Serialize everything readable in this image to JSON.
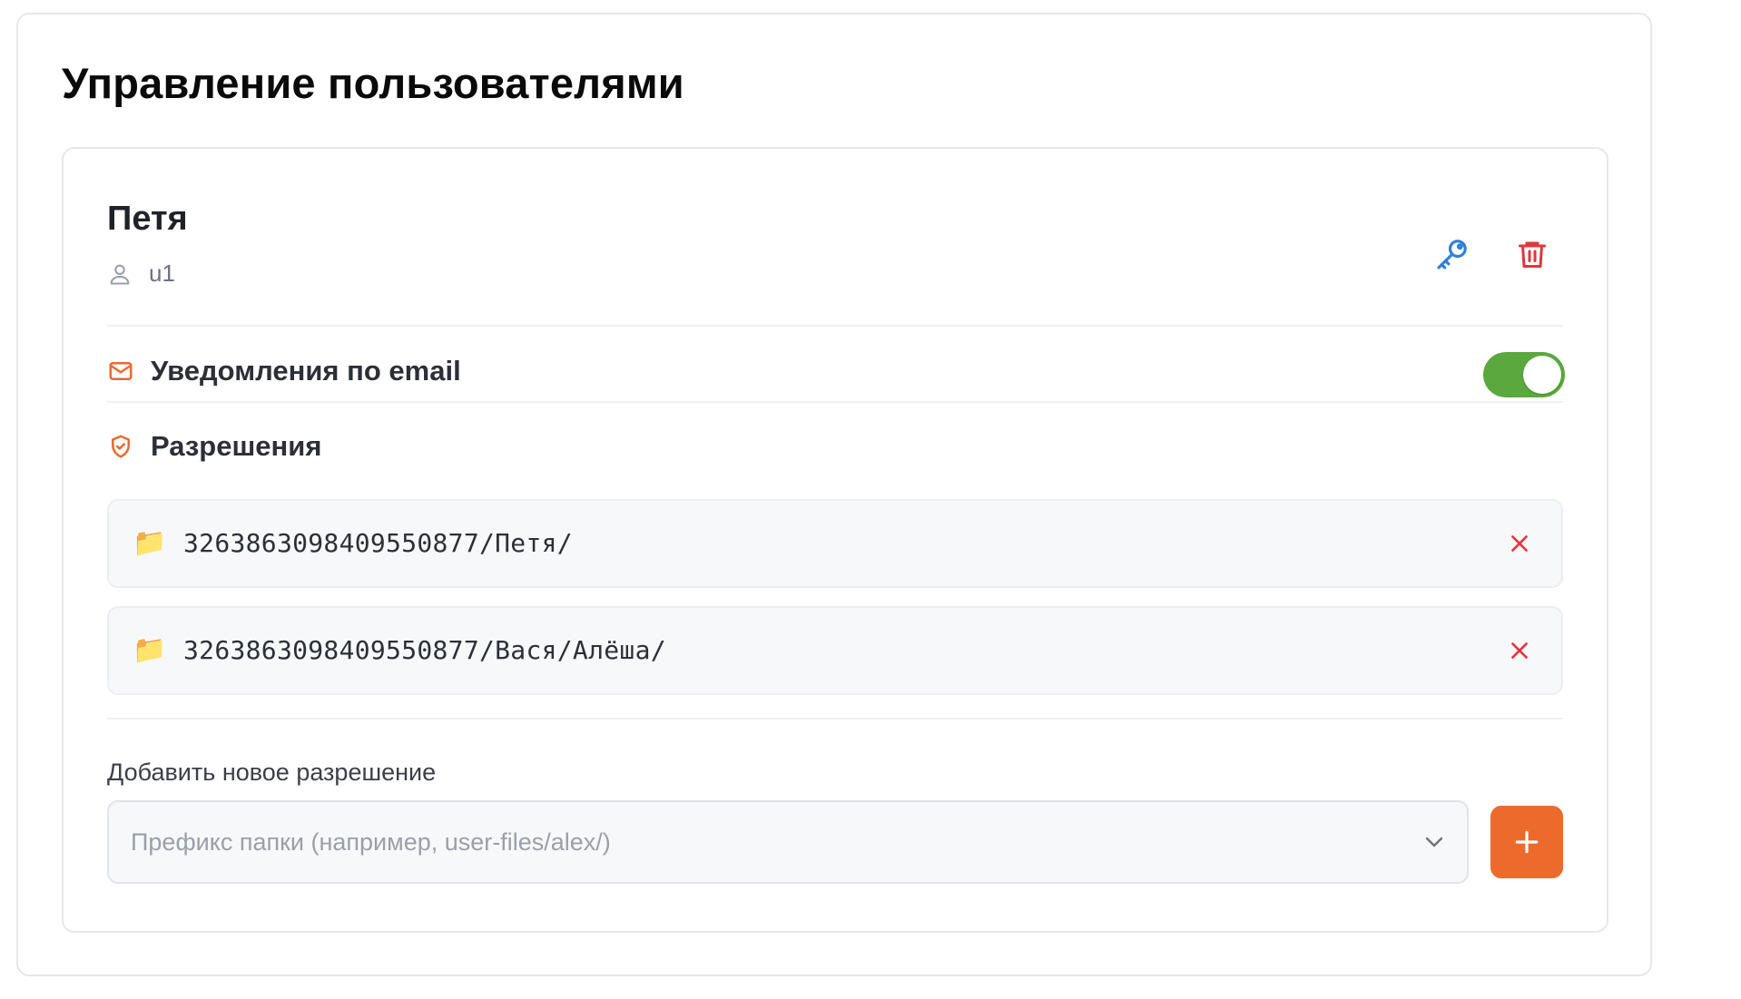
{
  "page": {
    "title": "Управление пользователями"
  },
  "user": {
    "name": "Петя",
    "login": "u1",
    "login_icon": "user-icon",
    "actions": {
      "reset_password_icon": "key-icon",
      "delete_icon": "trash-icon"
    }
  },
  "notifications": {
    "label": "Уведомления по email",
    "icon": "mail-icon",
    "enabled": true
  },
  "permissions": {
    "label": "Разрешения",
    "icon": "shield-check-icon",
    "items": [
      {
        "icon": "folder-icon",
        "folder_glyph": "📁",
        "path": "3263863098409550877/Петя/",
        "remove_icon": "close-icon"
      },
      {
        "icon": "folder-icon",
        "folder_glyph": "📁",
        "path": "3263863098409550877/Вася/Алёша/",
        "remove_icon": "close-icon"
      }
    ]
  },
  "add_permission": {
    "label": "Добавить новое разрешение",
    "placeholder": "Префикс папки (например, user-files/alex/)",
    "button_icon": "plus-icon"
  },
  "colors": {
    "accent_orange": "#ec6a2c",
    "toggle_on": "#5aa83e",
    "key_blue": "#2f7fd8",
    "danger_red": "#e0373c"
  }
}
